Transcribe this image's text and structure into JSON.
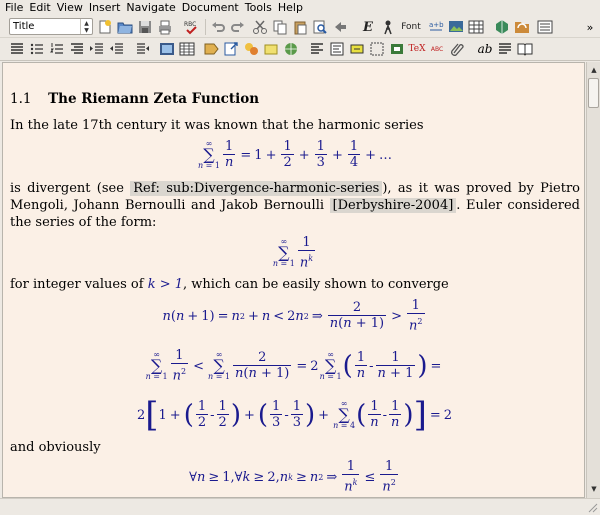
{
  "menu": [
    "File",
    "Edit",
    "View",
    "Insert",
    "Navigate",
    "Document",
    "Tools",
    "Help"
  ],
  "toolbar": {
    "style_combo": "Title",
    "font_label": "Font",
    "emph_glyph": "E",
    "tex_glyph": "TeX",
    "abc_glyph": "ABC",
    "ab_glyph": "ab",
    "overflow": "»"
  },
  "doc": {
    "section_number": "1.1",
    "section_title": "The Riemann Zeta Function",
    "p1": "In the late 17th century it was known that the harmonic series",
    "p2_before": "is divergent (see",
    "p2_ref": "Ref: sub:Divergence-harmonic-series",
    "p2_mid": "), as it was proved by Pietro Mengoli, Johann Bernoulli and Jakob Bernoulli",
    "p2_cite": "[Derbyshire-2004]",
    "p2_after": ". Euler considered the series of the form:",
    "p3_before": "for integer values of",
    "p3_math": "k > 1",
    "p3_after": ", which can be easily shown to converge",
    "p4": "and obviously"
  },
  "colors": {
    "page_bg": "#fbf0e6",
    "math": "#1a1a8e",
    "ui_bg": "#ede9e3"
  }
}
